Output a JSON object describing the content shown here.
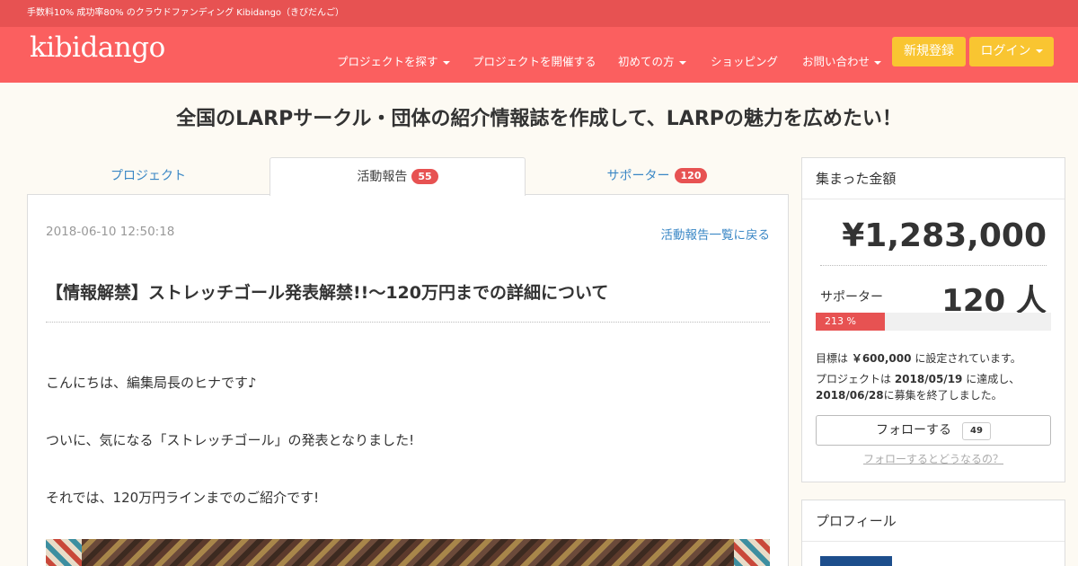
{
  "topbar": {
    "tagline": "手数料10% 成功率80% のクラウドファンディング Kibidango（きびだんご）"
  },
  "nav": {
    "logo": "kibidango",
    "items": [
      {
        "label": "プロジェクトを探す",
        "dropdown": true
      },
      {
        "label": "プロジェクトを開催する",
        "dropdown": false
      },
      {
        "label": "初めての方",
        "dropdown": true
      },
      {
        "label": "ショッピング",
        "dropdown": false
      },
      {
        "label": "お問い合わせ",
        "dropdown": true
      }
    ],
    "signup_label": "新規登録",
    "login_label": "ログイン"
  },
  "page": {
    "title": "全国のLARPサークル・団体の紹介情報誌を作成して、LARPの魅力を広めたい！",
    "tabs": [
      {
        "label": "プロジェクト"
      },
      {
        "label": "活動報告",
        "count": "55"
      },
      {
        "label": "サポーター",
        "count": "120"
      }
    ]
  },
  "post": {
    "date": "2018-06-10 12:50:18",
    "back_link": "活動報告一覧に戻る",
    "title": "【情報解禁】ストレッチゴール発表解禁!!〜120万円までの詳細について",
    "paragraphs": [
      "こんにちは、編集局長のヒナです♪",
      "ついに、気になる「ストレッチゴール」の発表となりました!",
      "それでは、120万円ラインまでのご紹介です!"
    ]
  },
  "funding": {
    "heading": "集まった金額",
    "amount": "¥1,283,000",
    "supporters_label": "サポーター",
    "supporters_count": "120 人",
    "progress_label": "213 %",
    "progress_fraction": 1.0,
    "goal_prefix": "目標は ",
    "goal_amount": "￥600,000",
    "goal_suffix": " に設定されています。",
    "achieved_prefix": "プロジェクトは ",
    "achieved_date": "2018/05/19",
    "achieved_suffix": " に達成し、",
    "end_date": "2018/06/28",
    "end_suffix": "に募集を終了しました。",
    "follow_label": "フォローする",
    "follow_count": "49",
    "follow_help": "フォローするとどうなるの？"
  },
  "profile": {
    "heading": "プロフィール"
  },
  "colors": {
    "brand": "#fb5f5f",
    "brand_dark": "#e75252",
    "accent_yellow": "#f9c531",
    "link": "#3a87c5"
  }
}
